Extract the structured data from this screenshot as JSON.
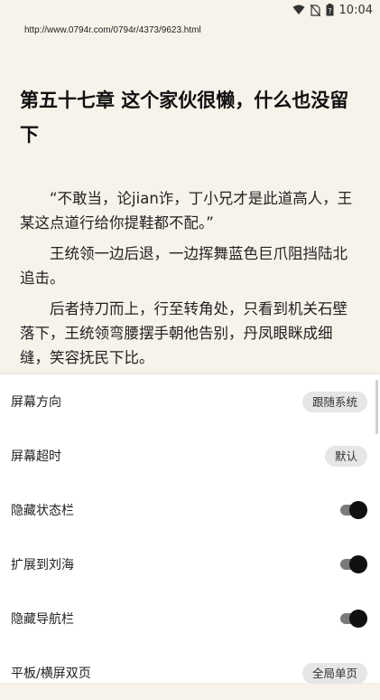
{
  "status_bar": {
    "time": "10:04",
    "icons": [
      "wifi-icon",
      "no-sim-icon",
      "battery-icon"
    ]
  },
  "reader": {
    "url": "http://www.0794r.com/0794r/4373/9623.html",
    "chapter_title": "第五十七章 这个家伙很懒，什么也没留下",
    "paragraphs": [
      "“不敢当，论jian诈，丁小兄才是此道高人，王某这点道行给你提鞋都不配。”",
      "王统领一边后退，一边挥舞蓝色巨爪阻挡陆北追击。",
      "后者持刀而上，行至转角处，只看到机关石壁落下，王统领弯腰摆手朝他告别，丹凤眼眯成细缝，笑容抚民下比。"
    ]
  },
  "settings": {
    "screen_orientation": {
      "label": "屏幕方向",
      "value": "跟随系统"
    },
    "screen_timeout": {
      "label": "屏幕超时",
      "value": "默认"
    },
    "hide_status_bar": {
      "label": "隐藏状态栏",
      "enabled": true
    },
    "extend_to_notch": {
      "label": "扩展到刘海",
      "enabled": true
    },
    "hide_nav_bar": {
      "label": "隐藏导航栏",
      "enabled": true
    },
    "tablet_dual_page": {
      "label": "平板/横屏双页",
      "value": "全局单页"
    }
  }
}
